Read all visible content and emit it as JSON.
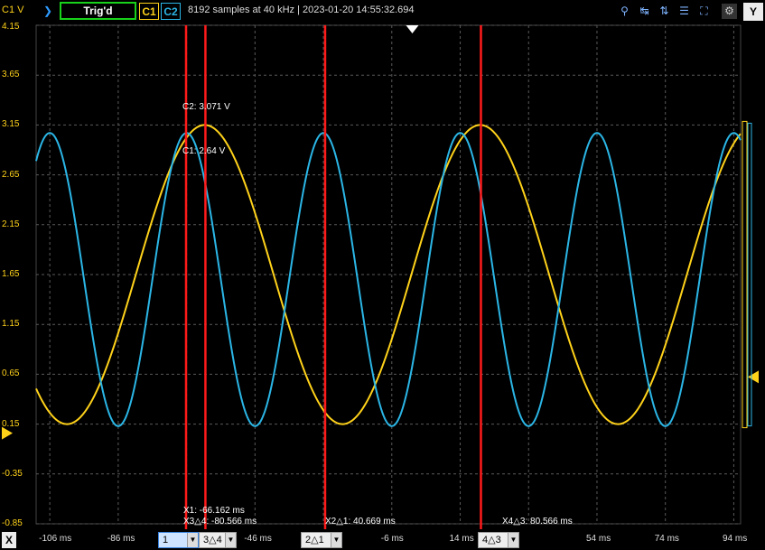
{
  "toolbar": {
    "channel_axis_label": "C1 V",
    "trigger_status": "Trig'd",
    "c1_label": "C1",
    "c2_label": "C2",
    "status": "8192 samples at 40 kHz | 2023-01-20 14:55:32.694",
    "y_button": "Y",
    "icons": [
      "zoom-in-icon",
      "cursor-x-icon",
      "cursor-y-icon",
      "list-icon",
      "zoom-fit-icon",
      "zoom-out-icon",
      "settings-icon"
    ]
  },
  "colors": {
    "c1": "#ffd21a",
    "c2": "#2bb6e6",
    "cursor": "#ff1a1a",
    "grid": "#5a5a5a"
  },
  "cursor_labels": {
    "c2_value": "C2: 3.071 V",
    "c1_value": "C1: 2.64 V",
    "x1": "X1: -66.162 ms",
    "x3_delta": "X3△4: -80.566 ms",
    "x2_delta": "X2△1: 40.669 ms",
    "x4_delta": "X4△3: 80.566 ms"
  },
  "bottom": {
    "x_button": "X",
    "drop1": "1",
    "drop2": "3△4",
    "drop3": "2△1",
    "drop4": "4△3"
  },
  "chart_data": {
    "type": "line",
    "xlabel": "",
    "ylabel": "C1 V",
    "xlim": [
      -110,
      96
    ],
    "ylim": [
      -0.85,
      4.15
    ],
    "x_ticks": [
      "-106 ms",
      "-86 ms",
      "-46 ms",
      "-6 ms",
      "14 ms",
      "54 ms",
      "74 ms",
      "94 ms"
    ],
    "x_tick_values": [
      -106,
      -86,
      -46,
      -6,
      14,
      54,
      74,
      94
    ],
    "y_ticks": [
      "4.15",
      "3.65",
      "3.15",
      "2.65",
      "2.15",
      "1.65",
      "1.15",
      "0.65",
      "0.15",
      "-0.35",
      "-0.85"
    ],
    "y_tick_values": [
      4.15,
      3.65,
      3.15,
      2.65,
      2.15,
      1.65,
      1.15,
      0.65,
      0.15,
      -0.35,
      -0.85
    ],
    "grid": true,
    "series": [
      {
        "name": "C1",
        "type": "sine",
        "offset": 1.65,
        "amplitude": 1.5,
        "period_ms": 80.566,
        "peak_at_ms": -60.7
      },
      {
        "name": "C2",
        "type": "sine",
        "offset": 1.6,
        "amplitude": 1.47,
        "period_ms": 40.0,
        "peak_at_ms": -66.0
      }
    ],
    "cursors_ms": {
      "X1": -66.162,
      "X2": -25.493,
      "X3": -60.5,
      "X4": 20.066
    }
  }
}
